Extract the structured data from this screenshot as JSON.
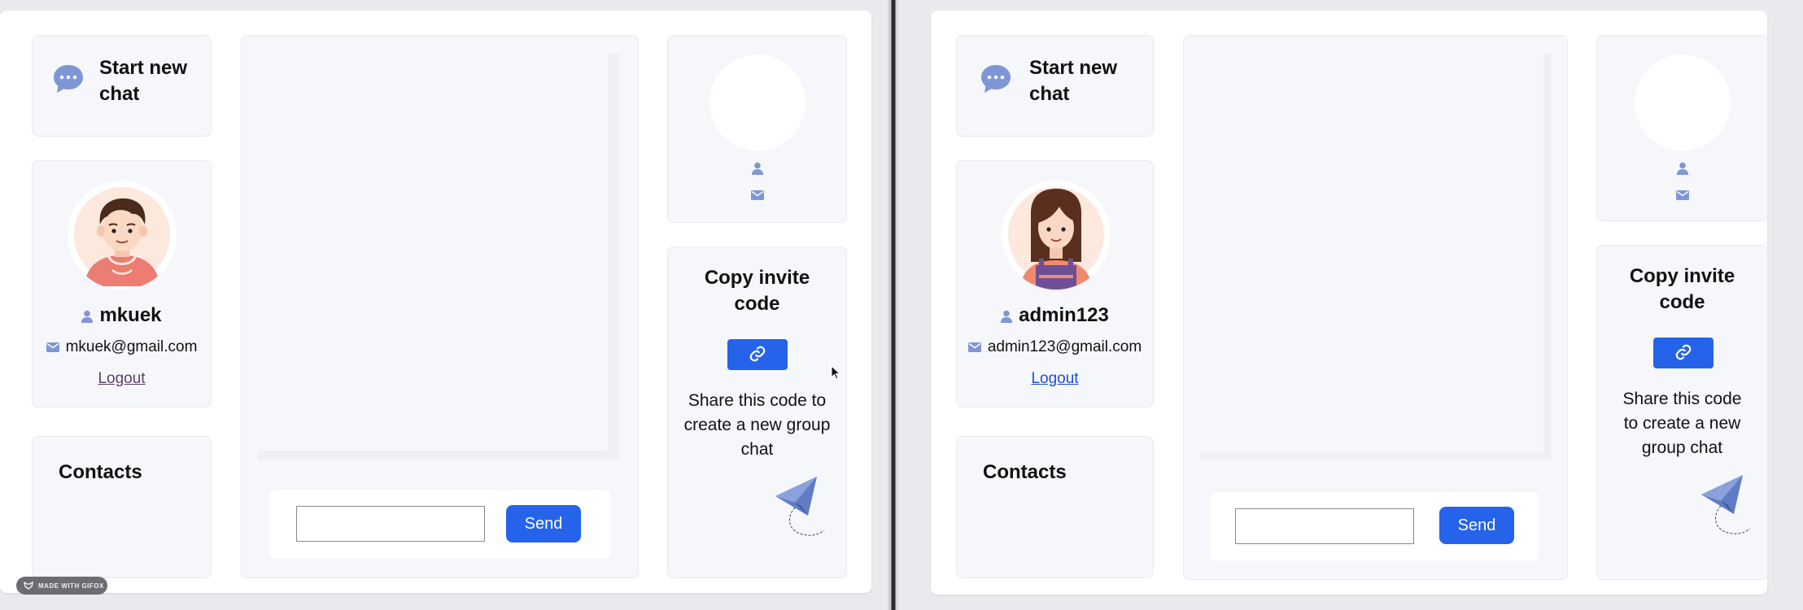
{
  "colors": {
    "accent": "#2563eb",
    "icon_blue": "#7f96d6",
    "card_bg": "#f6f7fb"
  },
  "left": {
    "new_chat_label": "Start new chat",
    "username": "mkuek",
    "email": "mkuek@gmail.com",
    "logout_label": "Logout",
    "contacts_title": "Contacts",
    "input_value": "",
    "send_label": "Send",
    "invite_title": "Copy invite code",
    "invite_desc": "Share this code to create a new group chat"
  },
  "right": {
    "new_chat_label": "Start new chat",
    "username": "admin123",
    "email": "admin123@gmail.com",
    "logout_label": "Logout",
    "contacts_title": "Contacts",
    "input_value": "",
    "send_label": "Send",
    "invite_title": "Copy invite code",
    "invite_desc": "Share this code to create a new group chat"
  },
  "badge_label": "MADE WITH GIFOX",
  "icons": [
    "chat-bubble-icon",
    "user-icon",
    "mail-icon",
    "link-icon",
    "paper-plane-icon",
    "gifox-icon",
    "mouse-cursor-icon"
  ]
}
